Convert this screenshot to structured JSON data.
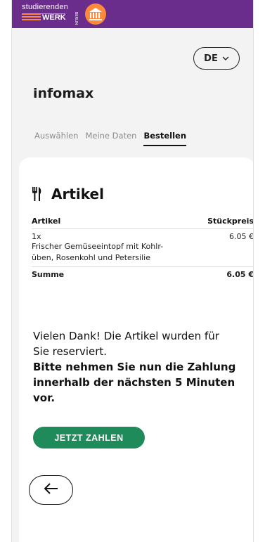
{
  "header": {
    "logo_top_text": "studierenden",
    "logo_bottom_text": "WERK",
    "logo_side_text": "BERLIN",
    "brand_color": "#6b2d8c",
    "accent_color": "#ff8a3c"
  },
  "language": {
    "value": "DE",
    "icon": "chevron-down-icon"
  },
  "app_title": "infomax",
  "tabs": [
    {
      "label": "Auswählen",
      "active": false
    },
    {
      "label": "Meine Daten",
      "active": false
    },
    {
      "label": "Bestellen",
      "active": true
    }
  ],
  "section": {
    "icon": "cutlery-icon",
    "title": "Artikel"
  },
  "table": {
    "headers": [
      "Artikel",
      "Stückpreis"
    ],
    "items": [
      {
        "qty": "1x",
        "name": "Frischer Gemüseeintopf mit Kohlr-\nüben, Rosenkohl und Petersilie",
        "price": "6.05 €"
      }
    ],
    "sum_label": "Summe",
    "sum_value": "6.05 €"
  },
  "message": {
    "text": "Vielen Dank! Die Artikel wurden für Sie reserviert.",
    "bold_text": "Bitte nehmen Sie nun die Zahlung innerhalb der nächsten 5 Minuten vor."
  },
  "pay_button": {
    "label": "JETZT ZAHLEN",
    "color": "#1f8a5a"
  },
  "back_button": {
    "icon": "arrow-left-icon"
  }
}
